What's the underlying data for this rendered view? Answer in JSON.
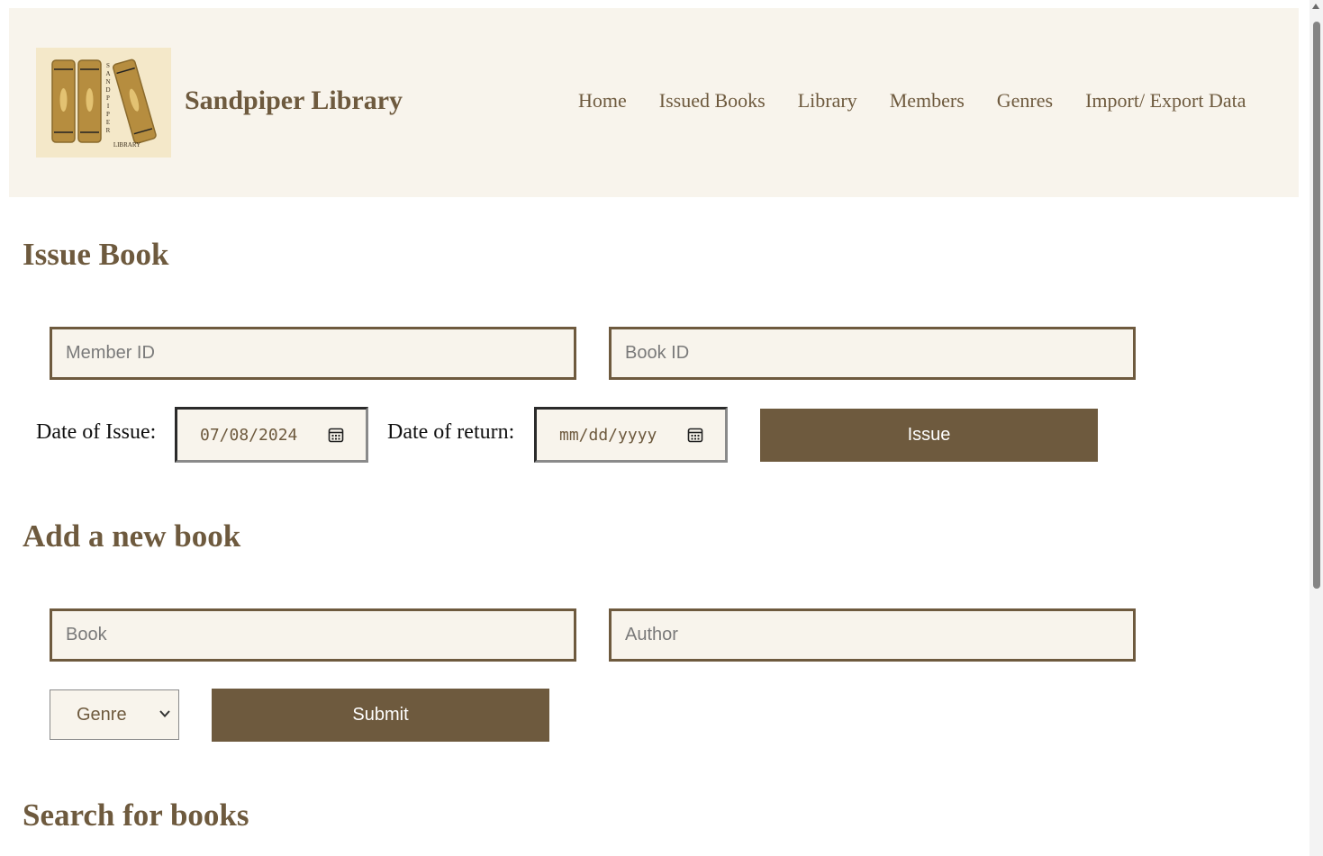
{
  "header": {
    "logo_text": "SANDPIPER LIBRARY",
    "brand": "Sandpiper Library",
    "nav": [
      "Home",
      "Issued Books",
      "Library",
      "Members",
      "Genres",
      "Import/ Export Data"
    ]
  },
  "issue": {
    "title": "Issue Book",
    "member_placeholder": "Member ID",
    "book_placeholder": "Book ID",
    "issue_date_label": "Date of Issue:",
    "issue_date_value": "07/08/2024",
    "return_date_label": "Date of return:",
    "return_date_placeholder": "mm/dd/yyyy",
    "button": "Issue"
  },
  "add_book": {
    "title": "Add a new book",
    "book_placeholder": "Book",
    "author_placeholder": "Author",
    "genre_selected": "Genre",
    "button": "Submit"
  },
  "search": {
    "title": "Search for books"
  },
  "colors": {
    "accent": "#6e5a3e",
    "header_bg": "#f8f4ec",
    "logo_bg": "#f4e8c9"
  }
}
